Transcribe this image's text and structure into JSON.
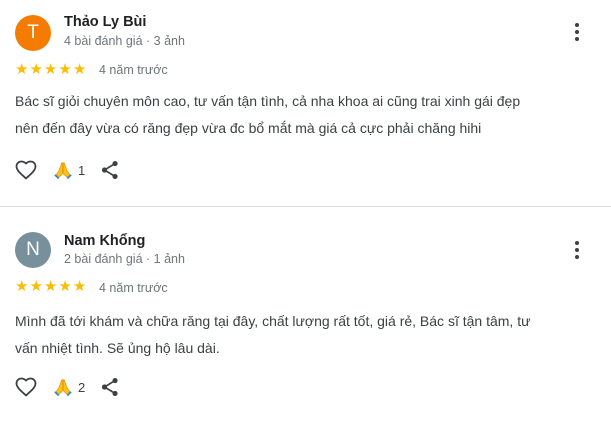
{
  "reviews": [
    {
      "avatar_letter": "T",
      "avatar_color": "#f57c00",
      "name": "Thảo Ly Bùi",
      "meta": "4 bài đánh giá · 3 ảnh",
      "rating": 5,
      "stars": [
        "★",
        "★",
        "★",
        "★",
        "★"
      ],
      "date": "4 năm trước",
      "text_lines": [
        "Bác sĩ giỏi chuyên môn cao, tư vấn tận tình, cả nha khoa ai cũng trai xinh gái đẹp",
        "nên đến đây vừa có răng đẹp vừa đc bổ mắt mà giá cả cực phải chăng hihi"
      ],
      "reaction_count": "1",
      "icons": {
        "like": "heart-outline-icon",
        "reaction": "folded-hands-icon",
        "share": "share-icon",
        "more": "more-vert-icon"
      }
    },
    {
      "avatar_letter": "N",
      "avatar_color": "#78909c",
      "name": "Nam Khổng",
      "meta": "2 bài đánh giá · 1 ảnh",
      "rating": 5,
      "stars": [
        "★",
        "★",
        "★",
        "★",
        "★"
      ],
      "date": "4 năm trước",
      "text_lines": [
        "Mình đã tới khám và chữa răng tại đây, chất lượng rất tốt, giá rẻ, Bác sĩ tận tâm, tư",
        "vấn nhiệt tình. Sẽ ủng hộ lâu dài."
      ],
      "reaction_count": "2",
      "icons": {
        "like": "heart-outline-icon",
        "reaction": "folded-hands-icon",
        "share": "share-icon",
        "more": "more-vert-icon"
      }
    }
  ],
  "colors": {
    "star": "#fbbc04",
    "meta_text": "#70757a",
    "divider": "#dadce0"
  }
}
